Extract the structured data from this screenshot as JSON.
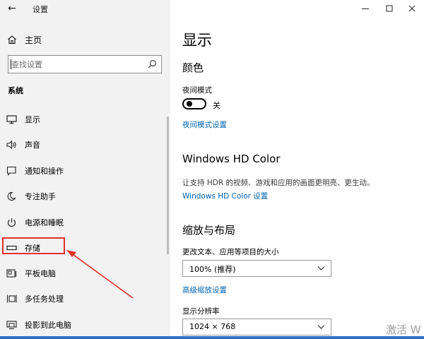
{
  "window": {
    "title": "设置",
    "back_icon": "back-arrow-icon",
    "controls": [
      "minimize-icon",
      "maximize-icon",
      "close-icon"
    ]
  },
  "sidebar": {
    "home": {
      "label": "主页",
      "icon": "home-icon"
    },
    "search": {
      "placeholder": "查找设置",
      "icon": "search-icon"
    },
    "section": "系统",
    "items": [
      {
        "label": "显示",
        "icon": "monitor-icon"
      },
      {
        "label": "声音",
        "icon": "speaker-icon"
      },
      {
        "label": "通知和操作",
        "icon": "notification-icon"
      },
      {
        "label": "专注助手",
        "icon": "moon-icon"
      },
      {
        "label": "电源和睡眠",
        "icon": "power-icon"
      },
      {
        "label": "存储",
        "icon": "storage-icon"
      },
      {
        "label": "平板电脑",
        "icon": "tablet-icon"
      },
      {
        "label": "多任务处理",
        "icon": "multitask-icon"
      },
      {
        "label": "投影到此电脑",
        "icon": "project-icon"
      }
    ],
    "annotation_color": "#e0302a"
  },
  "main": {
    "title": "显示",
    "color": {
      "heading": "颜色",
      "night_mode_label": "夜间模式",
      "night_mode_state": "关",
      "night_mode_on": false,
      "night_mode_link": "夜间模式设置"
    },
    "hdr": {
      "heading": "Windows HD Color",
      "description": "让支持 HDR 的视频、游戏和应用的画面更明亮、更生动。",
      "link": "Windows HD Color 设置"
    },
    "scale": {
      "heading": "缩放与布局",
      "size_label": "更改文本、应用等项目的大小",
      "size_value": "100% (推荐)",
      "advanced_link": "高级缩放设置",
      "resolution_label": "显示分辨率",
      "resolution_value": "1024 × 768"
    }
  },
  "colors": {
    "link": "#0063b1",
    "sidebar_bg": "#f2f2f2",
    "taskbar": "#2f6fc4"
  },
  "watermark": "激活 W"
}
